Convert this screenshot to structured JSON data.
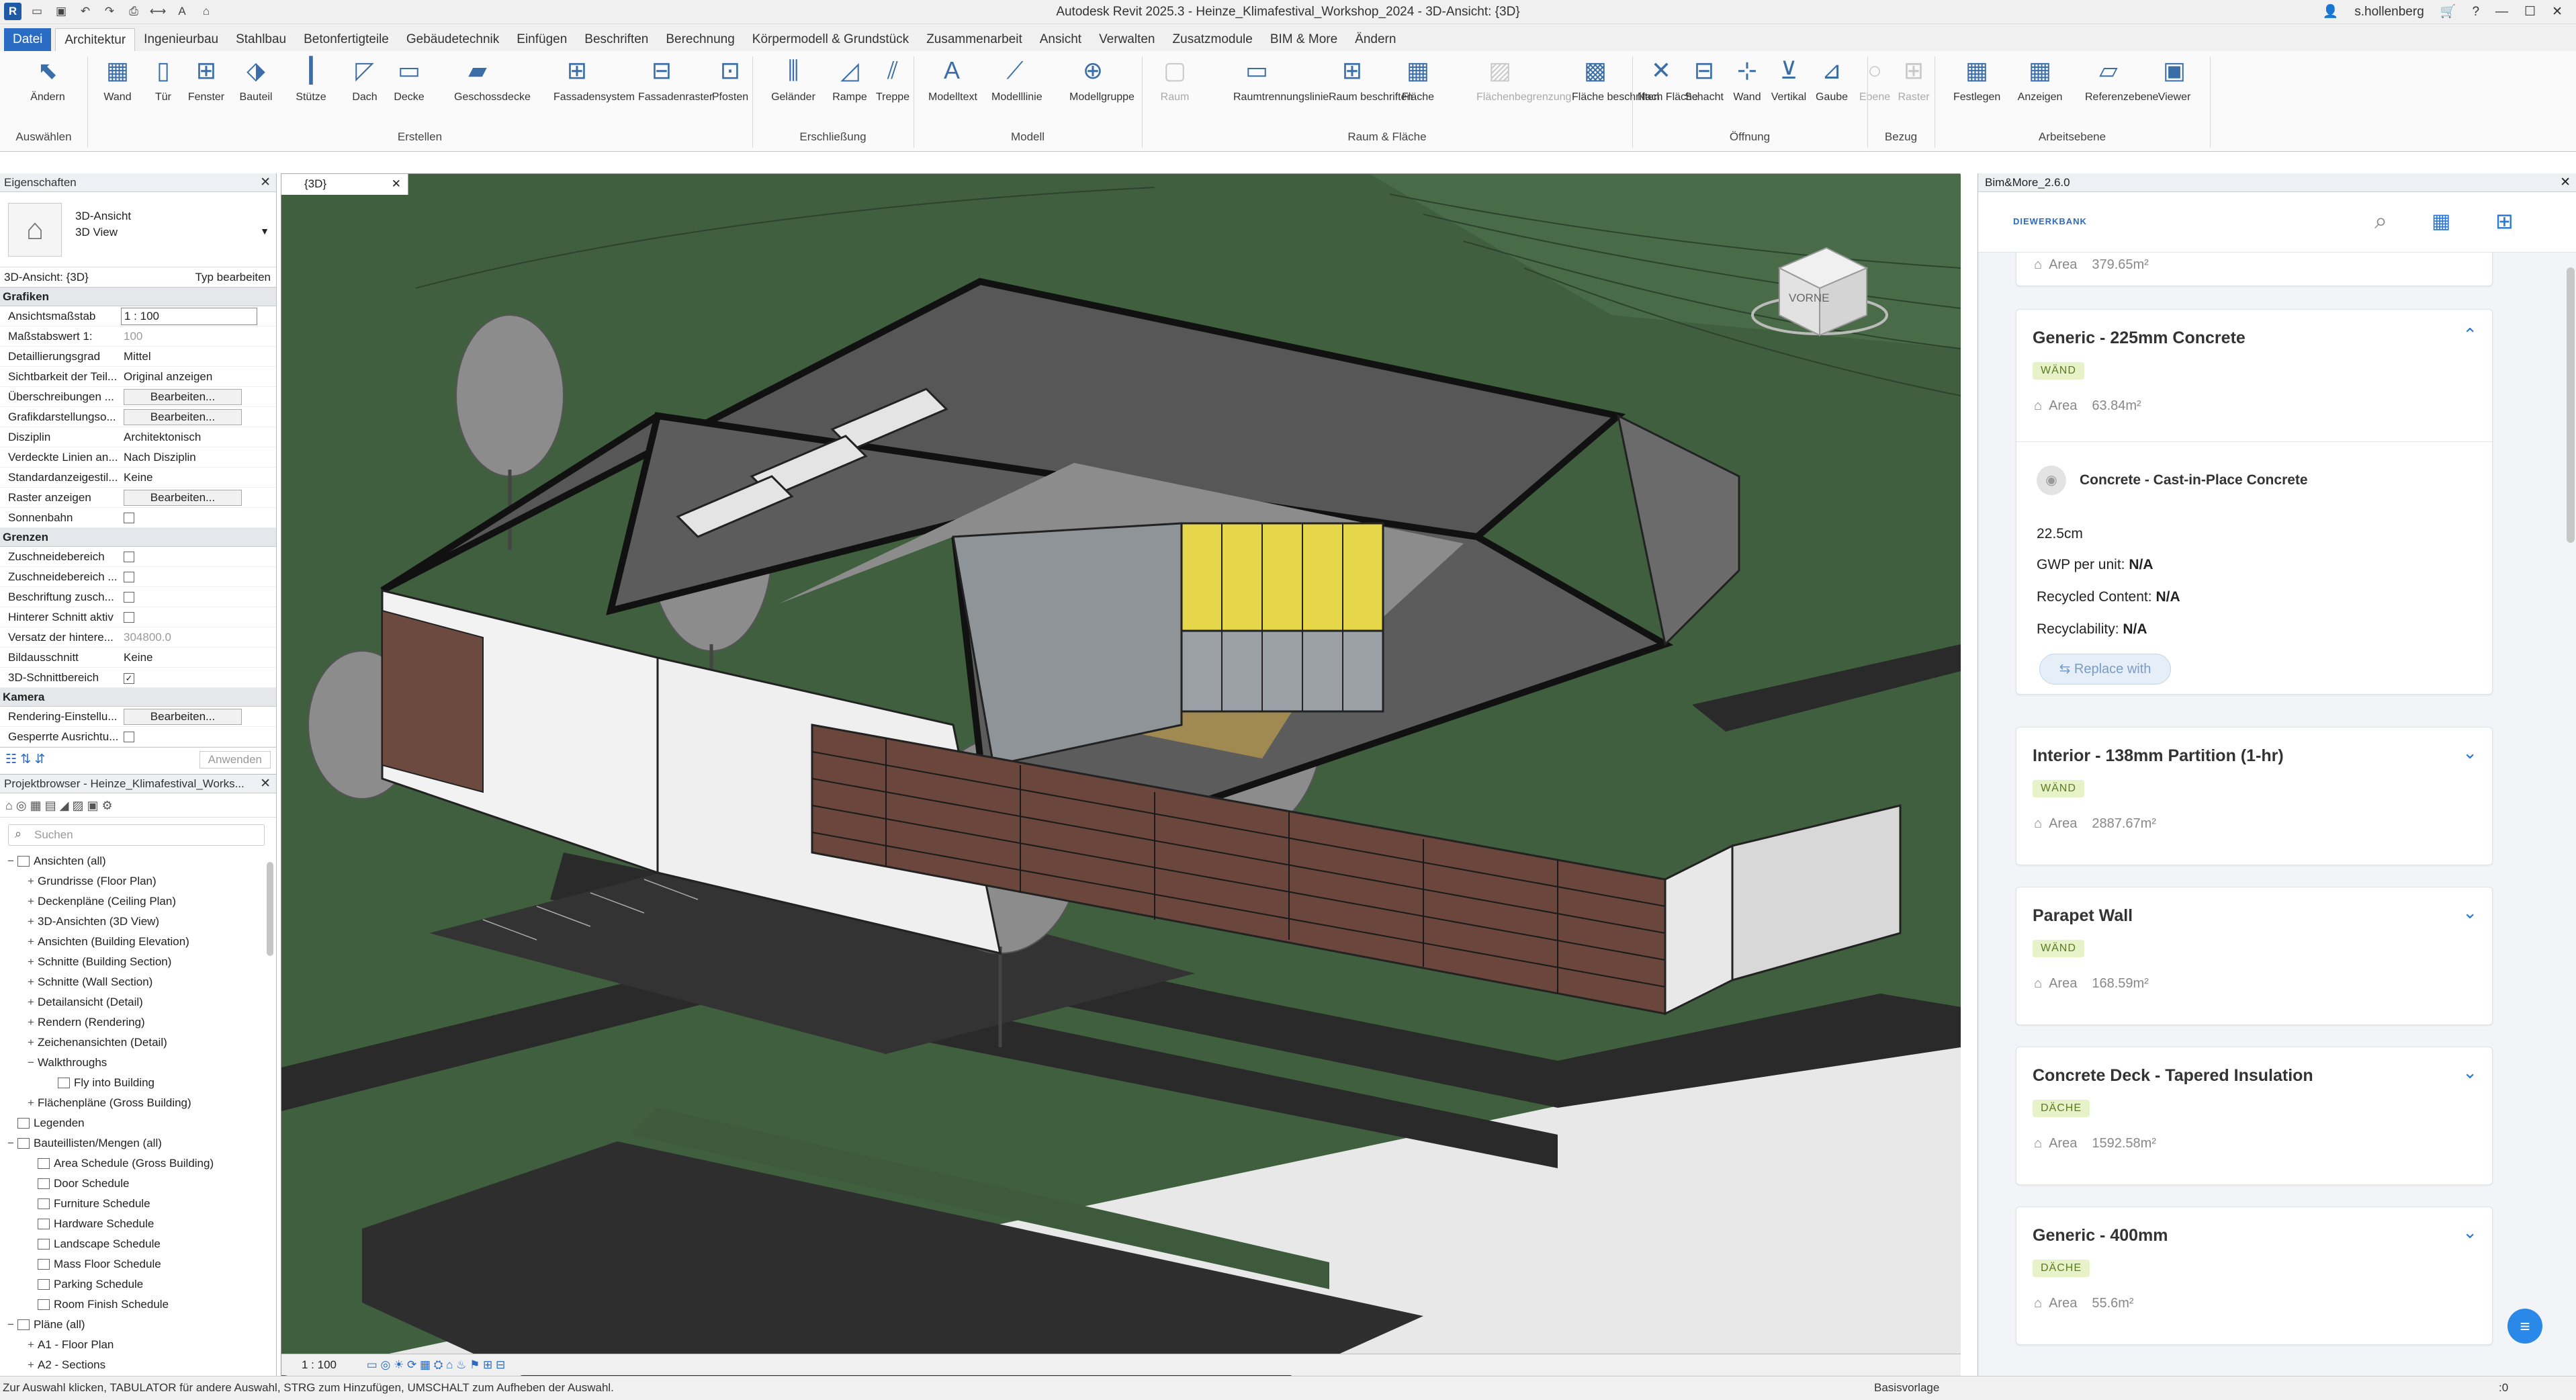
{
  "window": {
    "title": "Autodesk Revit 2025.3 - Heinze_Klimafestival_Workshop_2024 - 3D-Ansicht: {3D}",
    "user": "s.hollenberg"
  },
  "tabs": [
    "Datei",
    "Architektur",
    "Ingenieurbau",
    "Stahlbau",
    "Betonfertigteile",
    "Gebäudetechnik",
    "Einfügen",
    "Beschriften",
    "Berechnung",
    "Körpermodell & Grundstück",
    "Zusammenarbeit",
    "Ansicht",
    "Verwalten",
    "Zusatzmodule",
    "BIM & More",
    "Ändern"
  ],
  "ribbon": {
    "tools": [
      "Ändern",
      "Wand",
      "Tür",
      "Fenster",
      "Bauteil",
      "Stütze",
      "Dach",
      "Decke",
      "Geschossdecke",
      "Fassadensystem",
      "Fassadenraster",
      "Pfosten",
      "Geländer",
      "Rampe",
      "Treppe",
      "Modelltext",
      "Modelllinie",
      "Modellgruppe",
      "Raum",
      "Raumtrennungslinie",
      "Raum beschriften",
      "Fläche",
      "Flächenbegrenzung",
      "Fläche beschriften",
      "Nach Fläche",
      "Schacht",
      "Wand",
      "Vertikal",
      "Gaube",
      "Ebene",
      "Raster",
      "Festlegen",
      "Anzeigen",
      "Referenzebene",
      "Viewer"
    ],
    "groups": [
      "Auswählen",
      "Erstellen",
      "Erschließung",
      "Modell",
      "Raum & Fläche",
      "Öffnung",
      "Bezug",
      "Arbeitsebene"
    ]
  },
  "properties": {
    "header": "Eigenschaften",
    "type_line1": "3D-Ansicht",
    "type_line2": "3D View",
    "selector": "3D-Ansicht: {3D}",
    "edit_type": "Typ bearbeiten",
    "sec_graphics": "Grafiken",
    "rows_graphics": [
      {
        "k": "Ansichtsmaßstab",
        "v": "1 : 100"
      },
      {
        "k": "Maßstabswert 1:",
        "v": "100"
      },
      {
        "k": "Detaillierungsgrad",
        "v": "Mittel"
      },
      {
        "k": "Sichtbarkeit der Teil...",
        "v": "Original anzeigen"
      },
      {
        "k": "Überschreibungen ...",
        "v": "Bearbeiten..."
      },
      {
        "k": "Grafikdarstellungso...",
        "v": "Bearbeiten..."
      },
      {
        "k": "Disziplin",
        "v": "Architektonisch"
      },
      {
        "k": "Verdeckte Linien an...",
        "v": "Nach Disziplin"
      },
      {
        "k": "Standardanzeigestil...",
        "v": "Keine"
      },
      {
        "k": "Raster anzeigen",
        "v": "Bearbeiten..."
      },
      {
        "k": "Sonnenbahn",
        "v": ""
      }
    ],
    "sec_bounds": "Grenzen",
    "rows_bounds": [
      {
        "k": "Zuschneidebereich",
        "v": ""
      },
      {
        "k": "Zuschneidebereich ...",
        "v": ""
      },
      {
        "k": "Beschriftung zusch...",
        "v": ""
      },
      {
        "k": "Hinterer Schnitt aktiv",
        "v": ""
      },
      {
        "k": "Versatz der hintere...",
        "v": "304800.0"
      },
      {
        "k": "Bildausschnitt",
        "v": "Keine"
      },
      {
        "k": "3D-Schnittbereich",
        "v": ""
      }
    ],
    "sec_camera": "Kamera",
    "rows_camera": [
      {
        "k": "Rendering-Einstellu...",
        "v": "Bearbeiten..."
      },
      {
        "k": "Gesperrte Ausrichtu...",
        "v": ""
      }
    ],
    "apply": "Anwenden"
  },
  "browser": {
    "header": "Projektbrowser - Heinze_Klimafestival_Works...",
    "search": "Suchen",
    "items": [
      "Ansichten (all)",
      "Grundrisse (Floor Plan)",
      "Deckenpläne (Ceiling Plan)",
      "3D-Ansichten (3D View)",
      "Ansichten (Building Elevation)",
      "Schnitte (Building Section)",
      "Schnitte (Wall Section)",
      "Detailansicht (Detail)",
      "Rendern (Rendering)",
      "Zeichenansichten (Detail)",
      "Walkthroughs",
      "Fly into Building",
      "Flächenpläne (Gross Building)",
      "Legenden",
      "Bauteillisten/Mengen (all)",
      "Area Schedule (Gross Building)",
      "Door Schedule",
      "Furniture Schedule",
      "Hardware Schedule",
      "Landscape Schedule",
      "Mass Floor Schedule",
      "Parking Schedule",
      "Room Finish Schedule",
      "Pläne (all)",
      "A1 - Floor Plan",
      "A2 - Sections"
    ]
  },
  "view": {
    "tab": "{3D}",
    "scale": "1 : 100",
    "cube": "VORNE"
  },
  "status": {
    "text": "Zur Auswahl klicken, TABULATOR für andere Auswahl, STRG zum Hinzufügen, UMSCHALT zum Aufheben der Auswahl.",
    "model": "Basisvorlage",
    "count": ":0"
  },
  "bim": {
    "header": "Bim&More_2.6.0",
    "logo": "DIEWERKBANK",
    "partial_area": "379.65m²",
    "expanded": {
      "title": "Generic - 225mm Concrete",
      "badge": "WÄND",
      "area": "63.84m²",
      "material": "Concrete - Cast-in-Place Concrete",
      "thickness": "22.5cm",
      "gwp_label": "GWP per unit:",
      "gwp": "N/A",
      "recycled_label": "Recycled Content:",
      "recycled": "N/A",
      "recyc_label": "Recyclability:",
      "recyc": "N/A",
      "replace": "Replace with"
    },
    "area_label": "Area",
    "cards": [
      {
        "title": "Interior - 138mm Partition (1-hr)",
        "badge": "WÄND",
        "area": "2887.67m²"
      },
      {
        "title": "Parapet Wall",
        "badge": "WÄND",
        "area": "168.59m²"
      },
      {
        "title": "Concrete Deck - Tapered Insulation",
        "badge": "DÄCHE",
        "area": "1592.58m²"
      },
      {
        "title": "Generic - 400mm",
        "badge": "DÄCHE",
        "area": "55.6m²"
      }
    ]
  }
}
